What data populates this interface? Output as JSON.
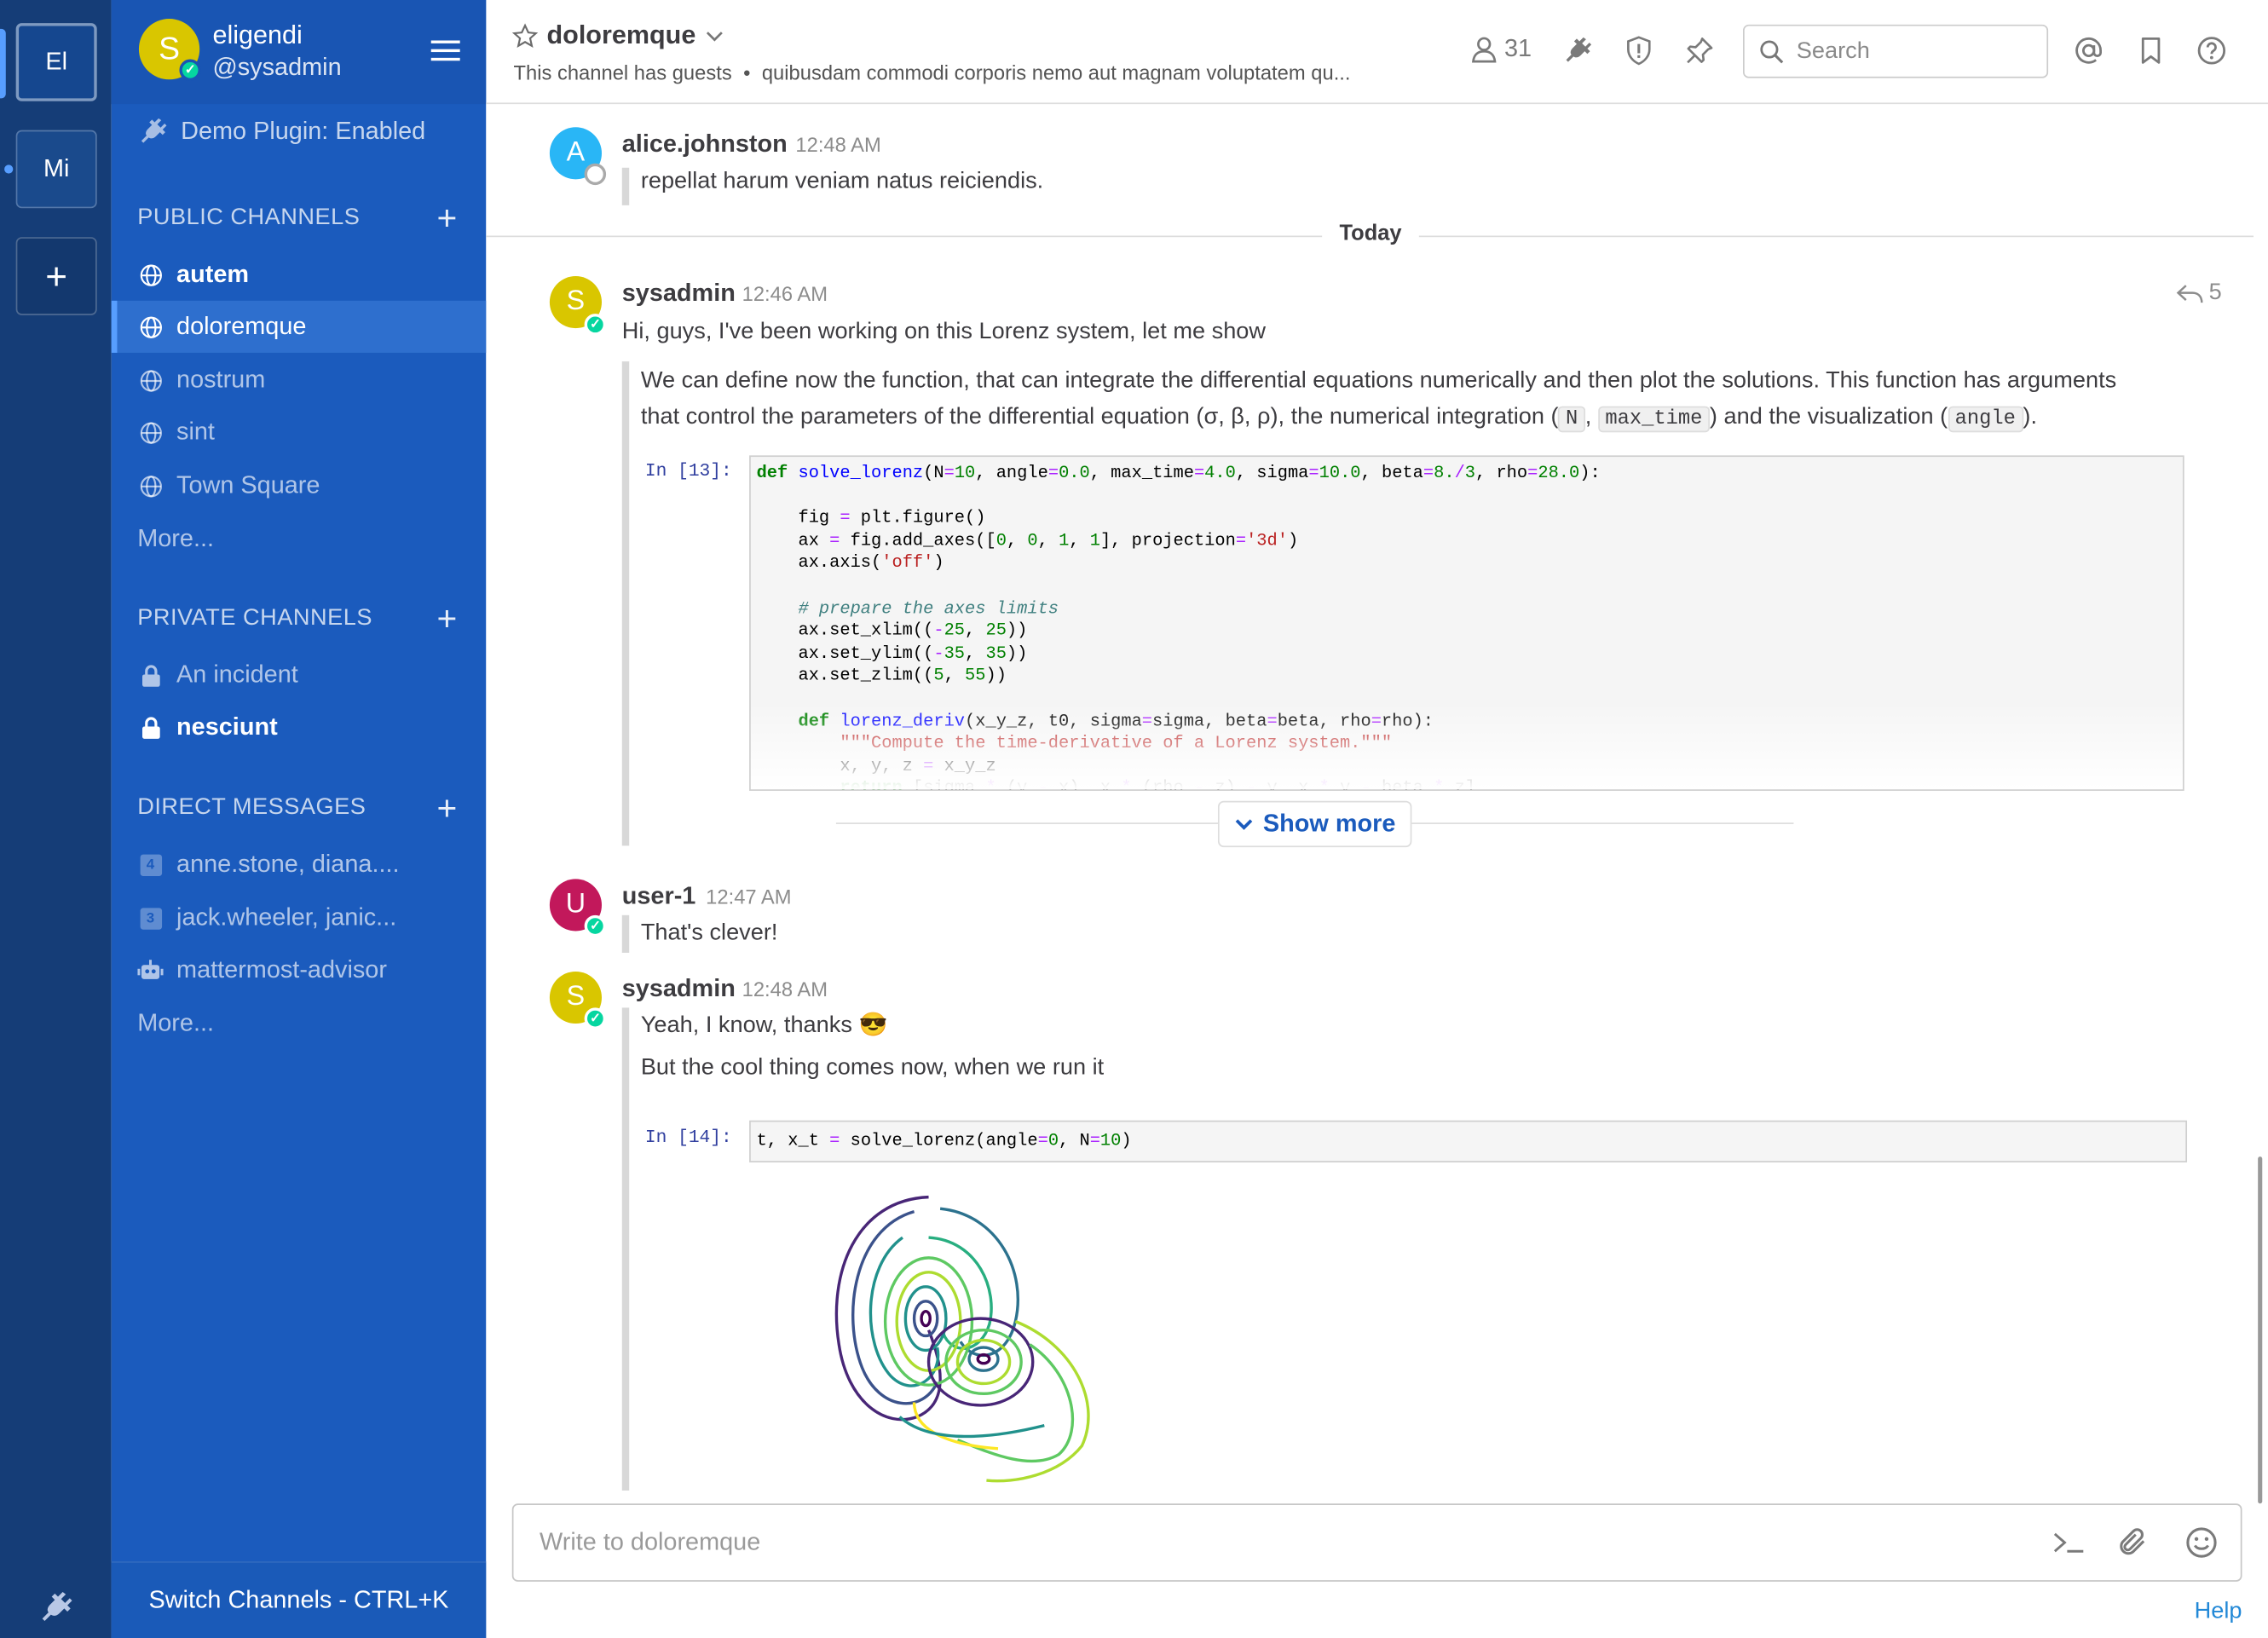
{
  "teams": [
    {
      "initials": "El"
    },
    {
      "initials": "Mi"
    },
    {
      "initials": "+"
    }
  ],
  "sidebar": {
    "team_name": "eligendi",
    "username": "@sysadmin",
    "avatar_initial": "S",
    "plugin_status": "Demo Plugin: Enabled",
    "public_title": "PUBLIC CHANNELS",
    "public_channels": [
      {
        "name": "autem"
      },
      {
        "name": "doloremque"
      },
      {
        "name": "nostrum"
      },
      {
        "name": "sint"
      },
      {
        "name": "Town Square"
      }
    ],
    "more_public": "More...",
    "private_title": "PRIVATE CHANNELS",
    "private_channels": [
      {
        "name": "An incident"
      },
      {
        "name": "nesciunt"
      }
    ],
    "dm_title": "DIRECT MESSAGES",
    "direct_messages": [
      {
        "name": "anne.stone, diana....",
        "count": "4"
      },
      {
        "name": "jack.wheeler, janic...",
        "count": "3"
      },
      {
        "name": "mattermost-advisor"
      }
    ],
    "more_dm": "More...",
    "footer": "Switch Channels - CTRL+K",
    "add_symbol": "+"
  },
  "header": {
    "channel_name": "doloremque",
    "guests_note": "This channel has guests",
    "separator": "•",
    "purpose": "quibusdam commodi corporis nemo aut magnam voluptatem qu...",
    "member_count": "31",
    "search_placeholder": "Search"
  },
  "messages": {
    "m1": {
      "initial": "A",
      "author": "alice.johnston",
      "time": "12:48 AM",
      "text": "repellat harum veniam natus reiciendis."
    },
    "divider": "Today",
    "m2": {
      "initial": "S",
      "author": "sysadmin",
      "time": "12:46 AM",
      "reply_count": "5",
      "text": "Hi, guys, I've been working on this Lorenz system, let me show",
      "para_line1": "We can define now the function, that can integrate the differential equations numerically and then plot the solutions. This function has arguments",
      "para_a": "that control the parameters of the differential equation (σ, β, ρ), the numerical integration (",
      "code_n": "N",
      "comma": ",",
      "code_max_time": "max_time",
      "para_b": ") and the visualization (",
      "code_angle": "angle",
      "para_c": ").",
      "prompt": "In [13]:",
      "show_more": "Show more"
    },
    "m3": {
      "initial": "U",
      "author": "user-1",
      "time": "12:47 AM",
      "text": "That's clever!"
    },
    "m4": {
      "initial": "S",
      "author": "sysadmin",
      "time": "12:48 AM",
      "text1": "Yeah, I know, thanks",
      "emoji": "😎",
      "text2": "But the cool thing comes now, when we run it",
      "prompt": "In [14]:"
    }
  },
  "composer": {
    "placeholder": "Write to doloremque"
  },
  "help": "Help",
  "colors": {
    "sidebar": "#1b5bbd",
    "team_sidebar": "#153d77",
    "online": "#06d6a0",
    "link": "#2389d7"
  }
}
